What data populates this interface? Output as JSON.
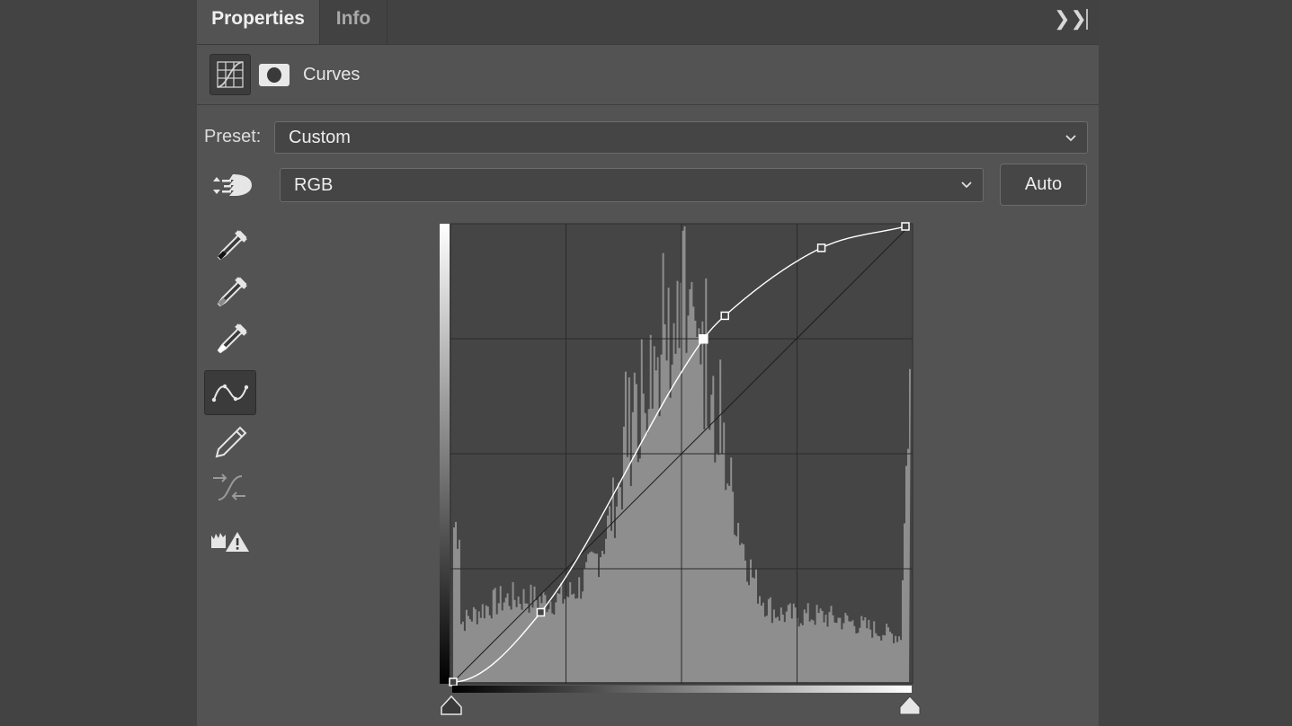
{
  "tabs": [
    {
      "label": "Properties",
      "active": true
    },
    {
      "label": "Info",
      "active": false
    }
  ],
  "header": {
    "adjustment_icon": "curves-grid-icon",
    "mask_icon": "layer-mask-icon",
    "title": "Curves"
  },
  "preset": {
    "label": "Preset:",
    "value": "Custom"
  },
  "channel": {
    "value": "RGB"
  },
  "auto_label": "Auto",
  "tools": [
    {
      "name": "targeted-adjustment-icon"
    },
    {
      "name": "sample-black-point-eyedropper-icon"
    },
    {
      "name": "sample-gray-point-eyedropper-icon"
    },
    {
      "name": "sample-white-point-eyedropper-icon"
    },
    {
      "name": "edit-points-curve-icon",
      "selected": true
    },
    {
      "name": "draw-pencil-icon"
    },
    {
      "name": "smooth-curve-icon"
    },
    {
      "name": "clipping-warning-icon"
    }
  ],
  "curve": {
    "input_range": [
      0,
      255
    ],
    "output_range": [
      0,
      255
    ],
    "grid": "4x4",
    "selected_point": 2,
    "points": [
      {
        "input": 0,
        "output": 0
      },
      {
        "input": 49,
        "output": 39
      },
      {
        "input": 140,
        "output": 192
      },
      {
        "input": 152,
        "output": 205
      },
      {
        "input": 206,
        "output": 243
      },
      {
        "input": 253,
        "output": 255
      }
    ]
  },
  "colors": {
    "panel_bg": "#535353",
    "graph_bg": "#454545",
    "histogram": "#8e8e8e",
    "curve": "#ffffff"
  }
}
